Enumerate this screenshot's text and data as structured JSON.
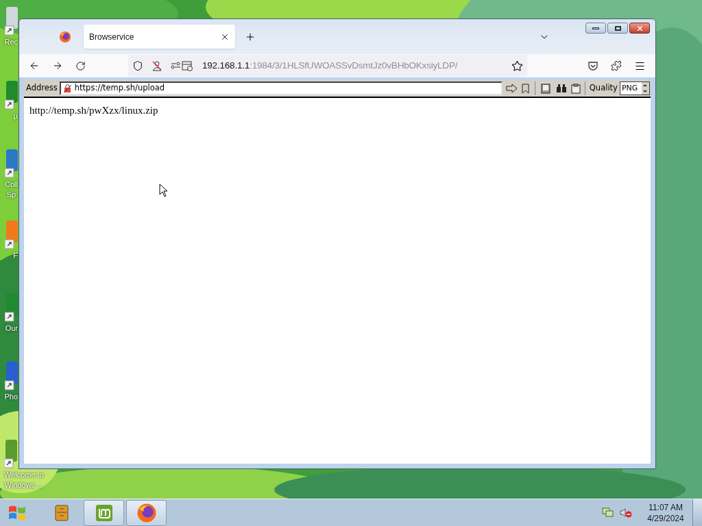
{
  "desktop": {
    "icons": [
      {
        "kind": "bin",
        "lines": [
          "Rec"
        ]
      },
      {
        "kind": "green",
        "lines": [
          "µ"
        ]
      },
      {
        "kind": "globe",
        "lines": [
          "Coll",
          "Sp"
        ]
      },
      {
        "kind": "orange",
        "lines": [
          "F"
        ]
      },
      {
        "kind": "green",
        "lines": [
          "Our"
        ]
      },
      {
        "kind": "blue",
        "lines": [
          "Pho"
        ]
      },
      {
        "kind": "welcome",
        "lines": [
          "Welcome to",
          "Windows ..."
        ]
      }
    ]
  },
  "browser": {
    "tabs": [
      {
        "title": "Browservice",
        "selected": true
      }
    ],
    "url": {
      "host": "192.168.1.1",
      "rest": ":1984/3/1HLSfUWOASSvDsmtJz0vBHbOKxsiyLDP/"
    },
    "toolbar": {
      "address_label": "Address",
      "address": "https://temp.sh/upload",
      "quality_label": "Quality",
      "quality": "PNG"
    },
    "page": {
      "text": "http://temp.sh/pwXzx/linux.zip"
    }
  },
  "taskbar": {
    "apps": [
      {
        "kind": "cabinet",
        "running": false
      },
      {
        "kind": "mint",
        "running": true
      },
      {
        "kind": "firefox",
        "running": true
      }
    ],
    "time": "11:07 AM",
    "date": "4/29/2024"
  }
}
